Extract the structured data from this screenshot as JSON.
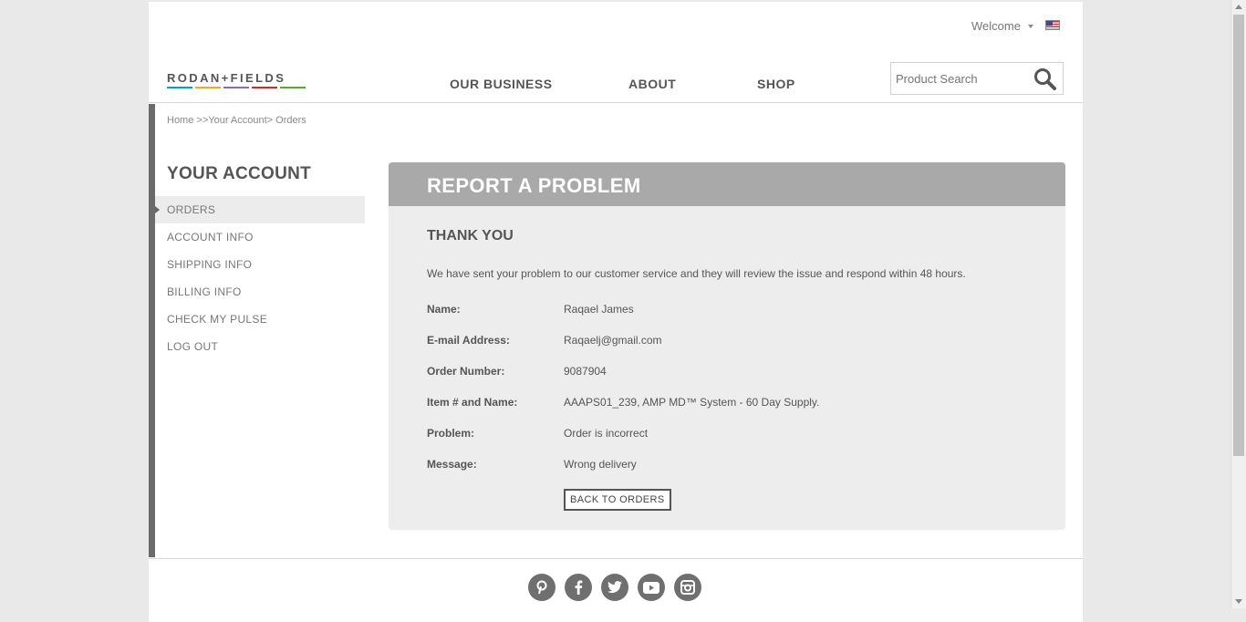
{
  "header": {
    "welcome": "Welcome",
    "logo_text": "RODAN+FIELDS",
    "logo_colors": [
      "#00a3c7",
      "#f5a623",
      "#8b6bb1",
      "#c9302c",
      "#5aa832"
    ],
    "nav": [
      "OUR BUSINESS",
      "ABOUT",
      "SHOP"
    ],
    "search_placeholder": "Product Search"
  },
  "breadcrumb": {
    "home": "Home",
    "sep1": " >>",
    "account": "Your Account",
    "sep2": "> ",
    "current": "Orders"
  },
  "sidebar": {
    "title": "YOUR ACCOUNT",
    "items": [
      "ORDERS",
      "ACCOUNT INFO",
      "SHIPPING INFO",
      "BILLING INFO",
      "CHECK MY PULSE",
      "LOG OUT"
    ],
    "active_index": 0
  },
  "panel": {
    "title": "REPORT A PROBLEM",
    "subtitle": "THANK YOU",
    "message": "We have sent your problem to our customer service and they will review the issue and respond within 48 hours.",
    "fields": [
      {
        "label": "Name:",
        "value": "Raqael James"
      },
      {
        "label": "E-mail Address:",
        "value": "Raqaelj@gmail.com"
      },
      {
        "label": "Order Number:",
        "value": "9087904"
      },
      {
        "label": "Item # and Name:",
        "value": "AAAPS01_239, AMP MD™ System - 60 Day Supply."
      },
      {
        "label": "Problem:",
        "value": "Order is incorrect"
      },
      {
        "label": "Message:",
        "value": "Wrong delivery"
      }
    ],
    "back_button": "BACK TO ORDERS"
  },
  "footer": {
    "social_icons": [
      "pinterest-icon",
      "facebook-icon",
      "twitter-icon",
      "youtube-icon",
      "instagram-icon"
    ]
  }
}
